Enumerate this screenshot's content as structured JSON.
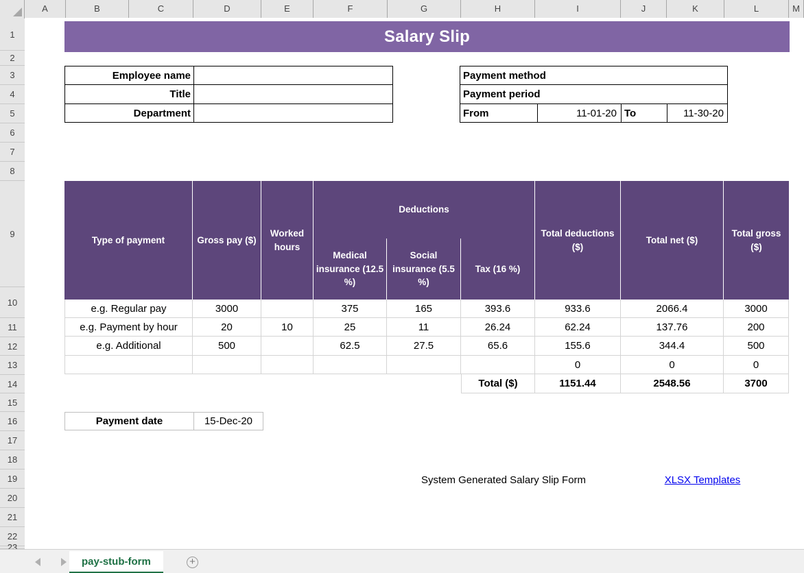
{
  "app": {
    "sheet_tab": "pay-stub-form",
    "add_sheet_icon": "plus-circle-icon",
    "nav_prev_icon": "triangle-left-icon",
    "nav_next_icon": "triangle-right-icon",
    "select_all_icon": "select-all-triangle-icon"
  },
  "grid": {
    "columns": [
      "A",
      "B",
      "C",
      "D",
      "E",
      "F",
      "G",
      "H",
      "I",
      "J",
      "K",
      "L",
      "M"
    ],
    "rows": [
      "1",
      "2",
      "3",
      "4",
      "5",
      "6",
      "7",
      "8",
      "9",
      "10",
      "11",
      "12",
      "13",
      "14",
      "15",
      "16",
      "17",
      "18",
      "19",
      "20",
      "21",
      "22",
      "23"
    ]
  },
  "colors": {
    "title_banner": "#8065a4",
    "table_header": "#5d467b",
    "header_text": "#ffffff",
    "link": "#0000ee",
    "tab_accent": "#217346"
  },
  "title": "Salary Slip",
  "employee": {
    "rows": [
      {
        "label": "Employee name",
        "value": ""
      },
      {
        "label": "Title",
        "value": ""
      },
      {
        "label": "Department",
        "value": ""
      }
    ]
  },
  "payment": {
    "method_label": "Payment method",
    "method_value": "",
    "period_label": "Payment period",
    "period_value": "",
    "from_label": "From",
    "from_value": "11-01-20",
    "to_label": "To",
    "to_value": "11-30-20"
  },
  "table": {
    "headers": {
      "type_of_payment": "Type of payment",
      "gross_pay": "Gross pay ($)",
      "worked_hours": "Worked hours",
      "deductions": "Deductions",
      "medical_insurance": "Medical insurance (12.5 %)",
      "social_insurance": "Social insurance (5.5 %)",
      "tax": "Tax (16 %)",
      "total_deductions": "Total deductions ($)",
      "total_net": "Total net ($)",
      "total_gross": "Total gross ($)"
    },
    "rows": [
      {
        "type": "e.g. Regular pay",
        "gross_pay": "3000",
        "worked_hours": "",
        "medical": "375",
        "social": "165",
        "tax": "393.6",
        "total_deductions": "933.6",
        "total_net": "2066.4",
        "total_gross": "3000"
      },
      {
        "type": "e.g. Payment by hour",
        "gross_pay": "20",
        "worked_hours": "10",
        "medical": "25",
        "social": "11",
        "tax": "26.24",
        "total_deductions": "62.24",
        "total_net": "137.76",
        "total_gross": "200"
      },
      {
        "type": "e.g. Additional",
        "gross_pay": "500",
        "worked_hours": "",
        "medical": "62.5",
        "social": "27.5",
        "tax": "65.6",
        "total_deductions": "155.6",
        "total_net": "344.4",
        "total_gross": "500"
      },
      {
        "type": "",
        "gross_pay": "",
        "worked_hours": "",
        "medical": "",
        "social": "",
        "tax": "",
        "total_deductions": "0",
        "total_net": "0",
        "total_gross": "0"
      }
    ],
    "total_row": {
      "label": "Total ($)",
      "total_deductions": "1151.44",
      "total_net": "2548.56",
      "total_gross": "3700"
    }
  },
  "payment_date": {
    "label": "Payment date",
    "value": "15-Dec-20"
  },
  "footer": {
    "note": "System Generated Salary Slip Form",
    "link": "XLSX Templates"
  }
}
